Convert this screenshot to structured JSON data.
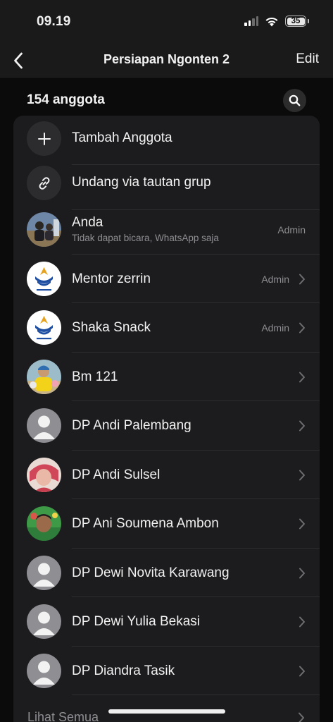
{
  "status_bar": {
    "time": "09.19",
    "battery": "35"
  },
  "nav": {
    "title": "Persiapan Ngonten 2",
    "edit_label": "Edit"
  },
  "members": {
    "count_label": "154 anggota",
    "actions": [
      {
        "label": "Tambah Anggota",
        "icon": "plus-icon"
      },
      {
        "label": "Undang via tautan grup",
        "icon": "link-icon"
      }
    ],
    "list": [
      {
        "name": "Anda",
        "subtitle": "Tidak dapat bicara, WhatsApp saja",
        "role": "Admin",
        "avatar": "photo-avatar"
      },
      {
        "name": "Mentor zerrin",
        "role": "Admin",
        "avatar": "academy-logo-avatar"
      },
      {
        "name": "Shaka Snack",
        "role": "Admin",
        "avatar": "academy-logo-avatar"
      },
      {
        "name": "Bm 121",
        "role": "",
        "avatar": "photo-avatar"
      },
      {
        "name": "DP Andi Palembang",
        "role": "",
        "avatar": "default-person-icon"
      },
      {
        "name": "DP Andi Sulsel",
        "role": "",
        "avatar": "photo-avatar"
      },
      {
        "name": "DP Ani Soumena Ambon",
        "role": "",
        "avatar": "photo-avatar"
      },
      {
        "name": "DP Dewi Novita Karawang",
        "role": "",
        "avatar": "default-person-icon"
      },
      {
        "name": "DP Dewi Yulia Bekasi",
        "role": "",
        "avatar": "default-person-icon"
      },
      {
        "name": "DP Diandra Tasik",
        "role": "",
        "avatar": "default-person-icon"
      }
    ],
    "see_all_label": "Lihat Semua"
  },
  "colors": {
    "background": "#0b0b0b",
    "card": "#1c1c1e",
    "secondary_text": "#8e8e93",
    "primary_text": "#f2f2f2"
  }
}
